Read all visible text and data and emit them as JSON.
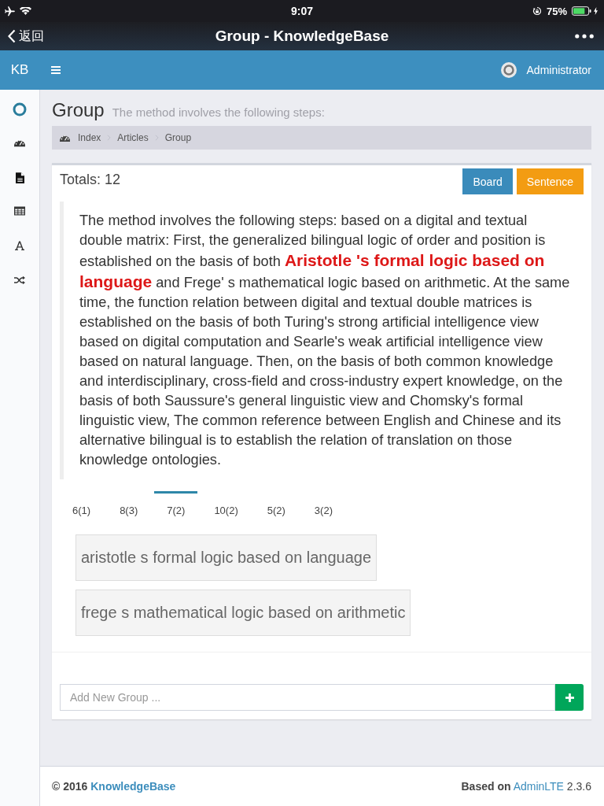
{
  "status_bar": {
    "time": "9:07",
    "battery": "75%"
  },
  "nav_bar": {
    "back": "返回",
    "title": "Group - KnowledgeBase"
  },
  "header": {
    "logo": "KB",
    "user": "Administrator"
  },
  "page_header": {
    "title": "Group",
    "subtitle": "The method involves the following steps:"
  },
  "breadcrumb": [
    "Index",
    "Articles",
    "Group"
  ],
  "box": {
    "totals": "Totals: 12",
    "buttons": [
      {
        "label": "Board",
        "kind": "primary"
      },
      {
        "label": "Sentence",
        "kind": "warning"
      }
    ],
    "quote": "The method involves the following steps: based on a digital and textual double matrix: First, the generalized bilingual logic of order and position is established on the basis of both **Aristotle 's formal logic based on language** and Frege' s mathematical logic based on arithmetic. At the same time, the function relation between digital and textual double matrices is established on the basis of both Turing's strong artificial intelligence view based on digital computation and Searle's weak artificial intelligence view based on natural language. Then, on the basis of both common knowledge and interdisciplinary, cross-field and cross-industry expert knowledge, on the basis of both Saussure's general linguistic view and Chomsky's formal linguistic view, The common reference between English and Chinese and its alternative bilingual is to establish the relation of translation on those knowledge ontologies.",
    "tabs": [
      {
        "label": "6(1)",
        "selected": false
      },
      {
        "label": "8(3)",
        "selected": false
      },
      {
        "label": "7(2)",
        "selected": true
      },
      {
        "label": "10(2)",
        "selected": false
      },
      {
        "label": "5(2)",
        "selected": false
      },
      {
        "label": "3(2)",
        "selected": false
      }
    ],
    "groups": [
      "aristotle s formal logic based on language",
      "frege s mathematical logic based on arithmetic"
    ],
    "add_group": {
      "placeholder": "Add New Group ..."
    }
  },
  "footer": {
    "copyright": "© 2016",
    "copyright_link": "KnowledgeBase",
    "credit": "Based on",
    "credit_link": "AdminLTE",
    "version": "2.3.6"
  }
}
